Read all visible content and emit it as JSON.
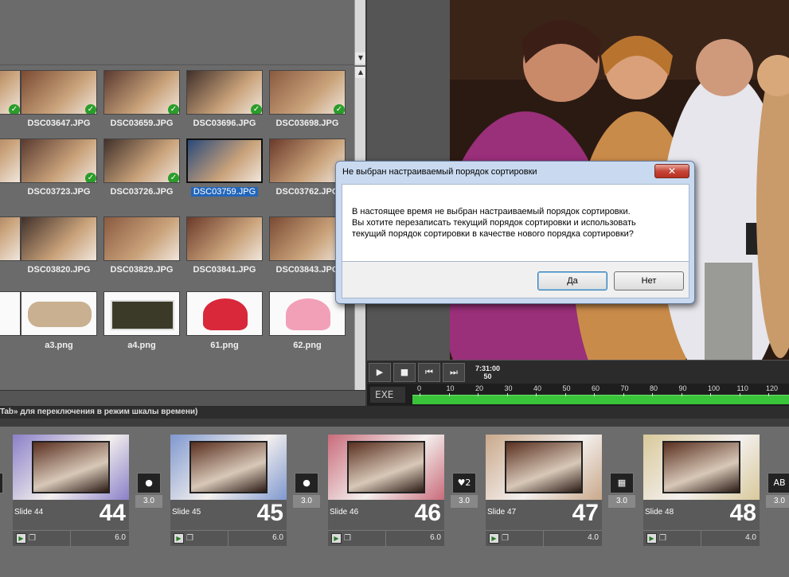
{
  "browser": {
    "rows": [
      [
        {
          "name": "",
          "check": true
        },
        {
          "name": "DSC03647.JPG",
          "check": true
        },
        {
          "name": "DSC03659.JPG",
          "check": true
        },
        {
          "name": "DSC03696.JPG",
          "check": true
        },
        {
          "name": "DSC03698.JPG",
          "check": true
        }
      ],
      [
        {
          "name": "",
          "check": false
        },
        {
          "name": "DSC03723.JPG",
          "check": true
        },
        {
          "name": "DSC03726.JPG",
          "check": true
        },
        {
          "name": "DSC03759.JPG",
          "check": false,
          "selected": true
        },
        {
          "name": "DSC03762.JPG",
          "check": false
        }
      ],
      [
        {
          "name": "",
          "check": false
        },
        {
          "name": "DSC03820.JPG",
          "check": false
        },
        {
          "name": "DSC03829.JPG",
          "check": false
        },
        {
          "name": "DSC03841.JPG",
          "check": false
        },
        {
          "name": "DSC03843.JPG",
          "check": false
        }
      ],
      [
        {
          "name": "",
          "check": false
        },
        {
          "name": "a3.png",
          "check": false
        },
        {
          "name": "a4.png",
          "check": false
        },
        {
          "name": "61.png",
          "check": false
        },
        {
          "name": "62.png",
          "check": false
        }
      ]
    ],
    "partial_names": [
      "G",
      "G",
      "G"
    ]
  },
  "transport": {
    "time": "7:31:00",
    "frames": "50",
    "play_icon": "play-icon",
    "stop_icon": "stop-icon",
    "prev_icon": "previous-icon",
    "next_icon": "next-icon"
  },
  "timeline": {
    "label": "EXE",
    "ticks": [
      "0",
      "10",
      "20",
      "30",
      "40",
      "50",
      "60",
      "70",
      "80",
      "90",
      "100",
      "110",
      "120"
    ]
  },
  "status": {
    "text": "Tab» для переключения в режим шкалы времени)"
  },
  "slides": [
    {
      "label": "Slide 44",
      "number": "44",
      "duration": "6.0",
      "color": "#8a7fc8"
    },
    {
      "label": "Slide 45",
      "number": "45",
      "duration": "6.0",
      "color": "#7f98cf"
    },
    {
      "label": "Slide 46",
      "number": "46",
      "duration": "6.0",
      "color": "#c96b7a"
    },
    {
      "label": "Slide 47",
      "number": "47",
      "duration": "4.0",
      "color": "#c9a88a"
    },
    {
      "label": "Slide 48",
      "number": "48",
      "duration": "4.0",
      "color": "#d8c99a"
    }
  ],
  "transitions": [
    {
      "duration": "3.0",
      "icon": "radial-fade-icon"
    },
    {
      "duration": "3.0",
      "icon": "radial-fade-icon"
    },
    {
      "duration": "3.0",
      "icon": "heart-icon"
    },
    {
      "duration": "3.0",
      "icon": "pixel-dissolve-icon"
    },
    {
      "duration": "3.0",
      "icon": "text-icon"
    }
  ],
  "dialog": {
    "title": "Не выбран настраиваемый порядок сортировки",
    "message_lines": [
      "В настоящее время не выбран настраиваемый порядок сортировки.",
      "Вы хотите перезаписать текущий порядок сортировки и использовать",
      "текущий порядок сортировки в качестве нового порядка сортировки?"
    ],
    "yes": "Да",
    "no": "Нет",
    "close": "✕"
  },
  "colors": {
    "accent": "#2266bb",
    "timeline": "#3ac43a",
    "check": "#2a9d2a"
  }
}
